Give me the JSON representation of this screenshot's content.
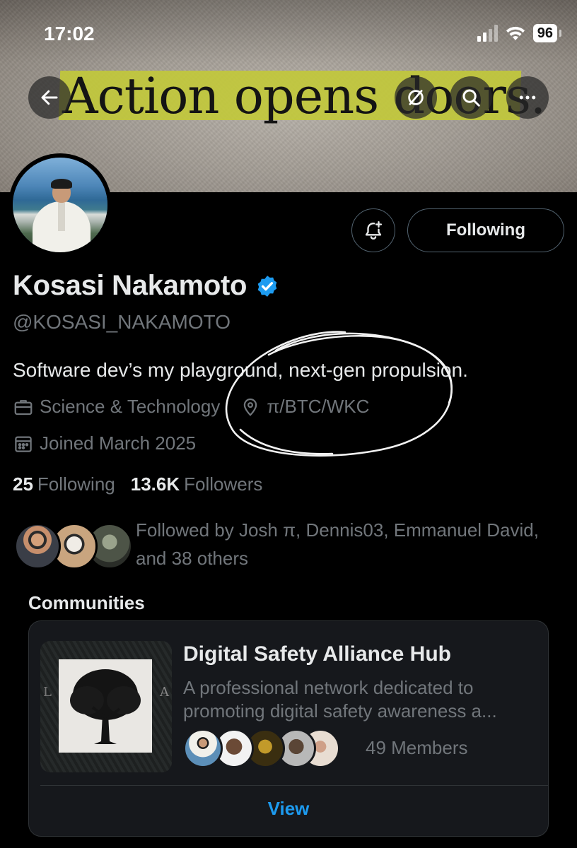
{
  "status_bar": {
    "time": "17:02",
    "battery": "96"
  },
  "banner": {
    "quote": "Action opens doors.",
    "highlight_color": "#c2c938"
  },
  "nav": {
    "back_icon": "arrow-left-icon",
    "grok_icon": "slash-circle-icon",
    "search_icon": "search-icon",
    "more_icon": "more-horizontal-icon"
  },
  "profile": {
    "name": "Kosasi Nakamoto",
    "handle": "@KOSASI_NAKAMOTO",
    "verified": true,
    "bio": "Software dev’s my playground, next-gen propulsion.",
    "category": "Science & Technology",
    "location": "π/BTC/WKC",
    "joined": "Joined March 2025",
    "following_count": "25",
    "following_label": "Following",
    "followers_count": "13.6K",
    "followers_label": "Followers",
    "followed_by": "Followed by Josh π, Dennis03, Emmanuel David, and 38 others"
  },
  "actions": {
    "notify_icon": "bell-plus-icon",
    "following_button": "Following"
  },
  "communities": {
    "title": "Communities",
    "items": [
      {
        "name": "Digital Safety Alliance Hub",
        "description": "A professional network dedicated to promoting digital safety awareness a...",
        "members": "49 Members",
        "view_label": "View",
        "thumb_left_letter": "L",
        "thumb_right_letter": "A"
      }
    ]
  },
  "colors": {
    "background": "#000000",
    "text_primary": "#e7e9ea",
    "text_secondary": "#71767b",
    "accent": "#1d9bf0",
    "border": "#2f3336"
  }
}
